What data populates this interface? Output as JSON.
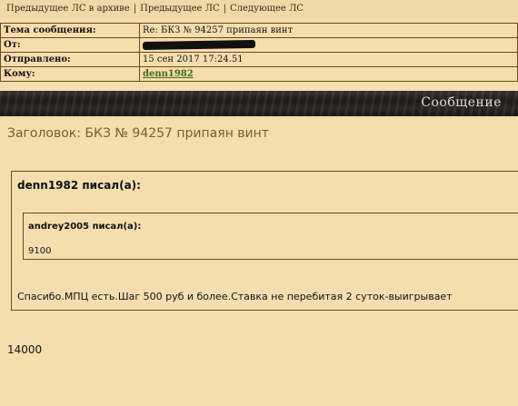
{
  "nav": {
    "archive_prev": "Предыдущее ЛС в архиве",
    "prev": "Предыдущее ЛС",
    "next": "Следующее ЛС",
    "separator": "|"
  },
  "header": {
    "subject_label": "Тема сообщения:",
    "subject_value": "Re: БКЗ № 94257 припаян винт",
    "from_label": "От:",
    "sent_label": "Отправлено:",
    "sent_value": "15 сен 2017 17:24.51",
    "to_label": "Кому:",
    "to_value": "denn1982"
  },
  "banner": {
    "title": "Сообщение"
  },
  "message": {
    "subject_line": "Заголовок: БКЗ № 94257 припаян винт",
    "outer_quote": {
      "author_line": "denn1982 писал(а):",
      "inner_quote": {
        "author_line": "andrey2005 писал(а):",
        "text": "9100"
      },
      "text": "Спасибо.МПЦ есть.Шаг 500 руб и более.Ставка не перебитая 2 суток-выигрывает"
    },
    "reply_text": "14000"
  }
}
